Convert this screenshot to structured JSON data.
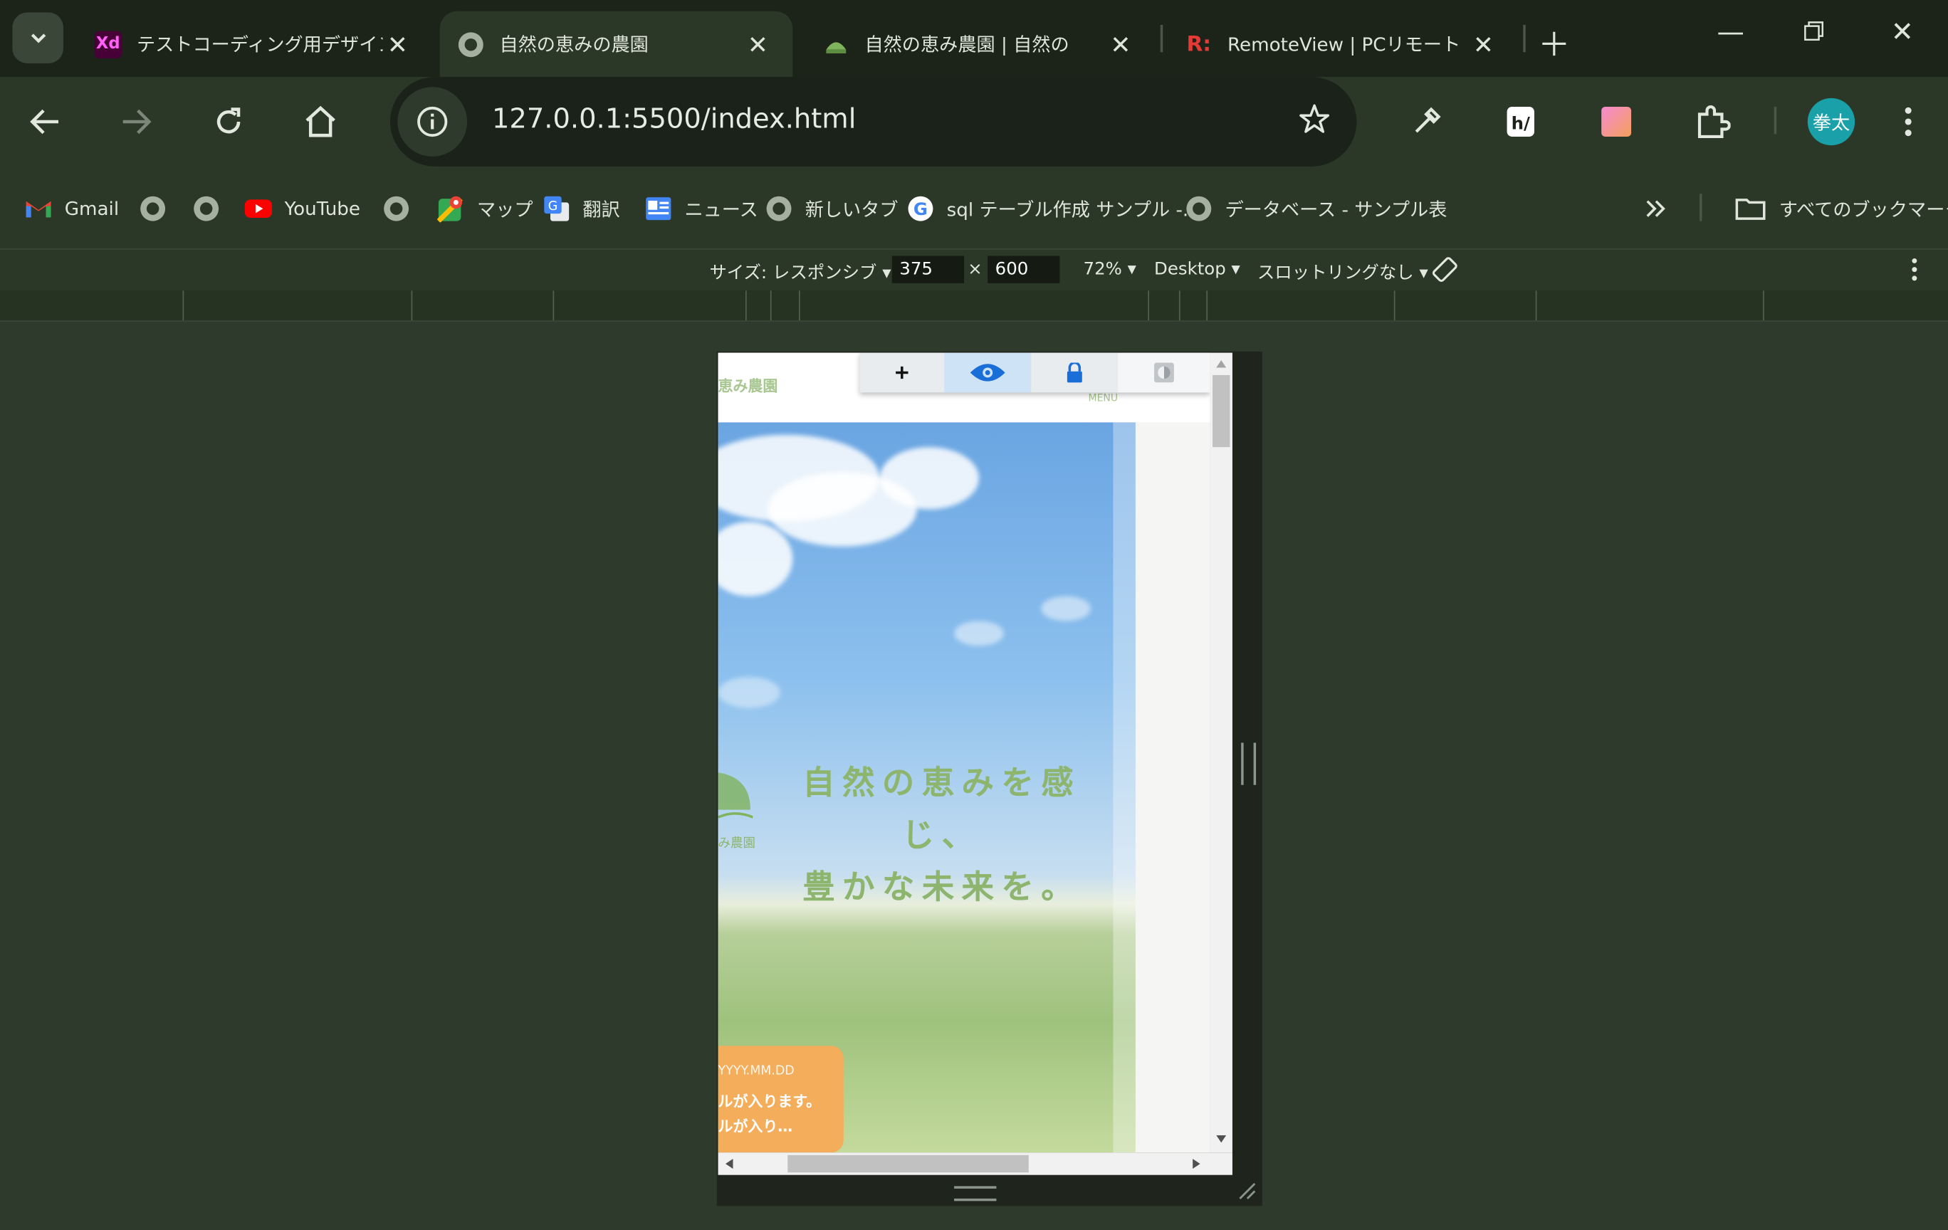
{
  "browser": {
    "tabs": [
      {
        "title": "テストコーディング用デザイン",
        "icon": "adobe-xd-icon",
        "badge": "Xd",
        "active": false
      },
      {
        "title": "自然の恵みの農園",
        "icon": "globe-icon",
        "active": true
      },
      {
        "title": "自然の恵み農園 | 自然の",
        "icon": "farm-logo-icon",
        "active": false
      },
      {
        "title": "RemoteView | PCリモート",
        "icon": "remoteview-icon",
        "active": false
      }
    ],
    "url": "127.0.0.1:5500/index.html",
    "avatar_text": "拳太",
    "bookmarks": [
      {
        "label": "Gmail",
        "icon": "gmail-icon"
      },
      {
        "label": "",
        "icon": "globe-icon"
      },
      {
        "label": "",
        "icon": "globe-icon"
      },
      {
        "label": "YouTube",
        "icon": "youtube-icon"
      },
      {
        "label": "",
        "icon": "globe-icon"
      },
      {
        "label": "マップ",
        "icon": "maps-icon"
      },
      {
        "label": "翻訳",
        "icon": "translate-icon"
      },
      {
        "label": "ニュース",
        "icon": "news-icon"
      },
      {
        "label": "新しいタブ",
        "icon": "globe-icon"
      },
      {
        "label": "sql テーブル作成 サンプル -...",
        "icon": "google-icon"
      },
      {
        "label": "データベース - サンプル表",
        "icon": "globe-icon"
      }
    ],
    "all_bookmarks": "すべてのブックマーク"
  },
  "devtools": {
    "size_label": "サイズ: レスポンシブ",
    "width": "375",
    "times": "×",
    "height": "600",
    "zoom": "72%",
    "device_type": "Desktop",
    "throttle": "スロットリングなし"
  },
  "page": {
    "logo_text": "恵み農園",
    "menu_label": "MENU",
    "hero_line1": "自然の恵みを感じ、",
    "hero_line2": "豊かな未来を。",
    "hero_logo_text": "み農園",
    "news_date": "YYYY.MM.DD",
    "news_line1": "ルが入ります。",
    "news_line2": "ルが入り…"
  },
  "colors": {
    "browser_frame": "#1c2319",
    "toolbar": "#2b3827",
    "hero_text": "#8db56e",
    "news_badge": "#f3ad5b",
    "avatar": "#1aa0a8"
  }
}
